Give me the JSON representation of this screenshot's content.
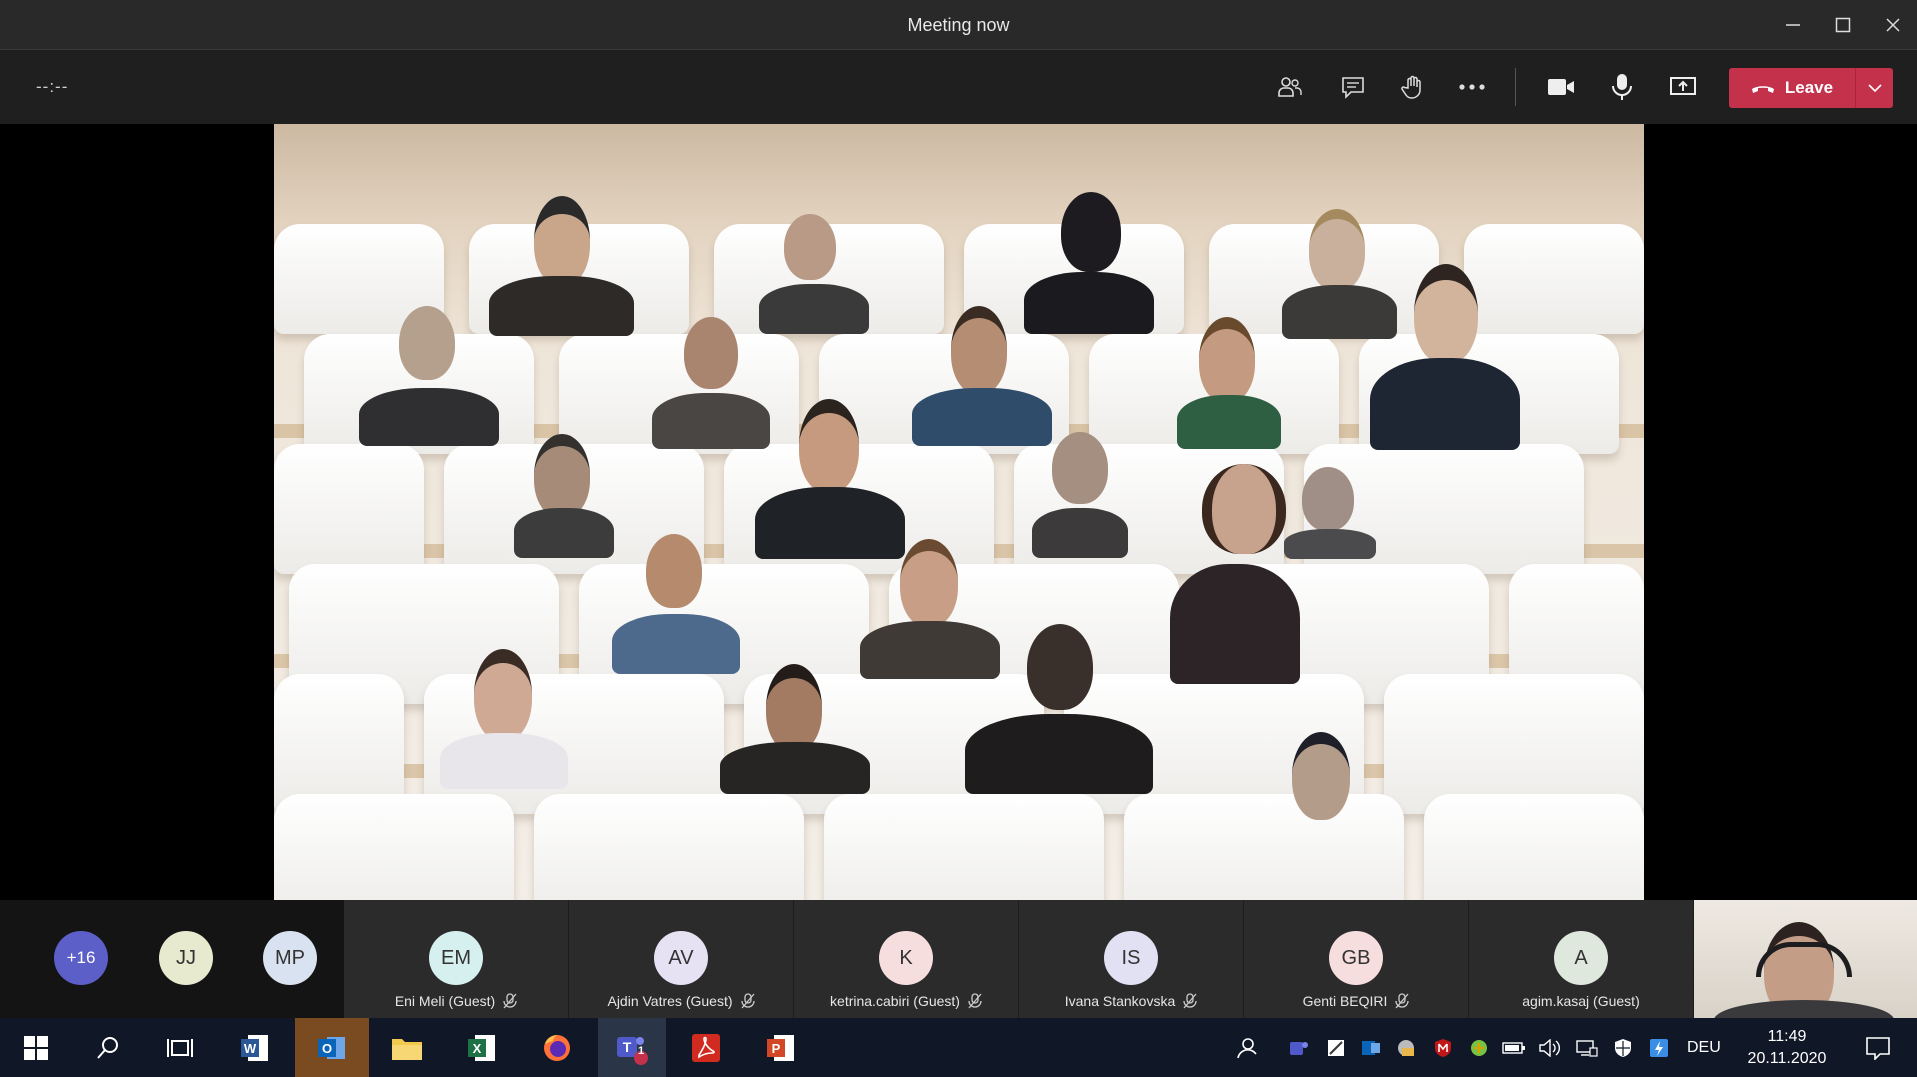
{
  "window": {
    "title": "Meeting now"
  },
  "toolbar": {
    "timer": "--:--",
    "leave_label": "Leave"
  },
  "roster": {
    "overflow_count": "+16",
    "compact": [
      {
        "initials": "JJ",
        "color": "#e8ead0"
      },
      {
        "initials": "MP",
        "color": "#d9e2f0"
      }
    ],
    "participants": [
      {
        "initials": "EM",
        "name": "Eni Meli (Guest)",
        "color": "#d5f0ee"
      },
      {
        "initials": "AV",
        "name": "Ajdin Vatres (Guest)",
        "color": "#e6e2f3"
      },
      {
        "initials": "K",
        "name": "ketrina.cabiri (Guest)",
        "color": "#f6dede"
      },
      {
        "initials": "IS",
        "name": "Ivana Stankovska",
        "color": "#e2e0f3"
      },
      {
        "initials": "GB",
        "name": "Genti BEQIRI",
        "color": "#f6dede"
      },
      {
        "initials": "A",
        "name": "agim.kasaj (Guest)",
        "color": "#dfe8dc"
      }
    ]
  },
  "taskbar": {
    "language": "DEU",
    "time": "11:49",
    "date": "20.11.2020",
    "teams_badge": "1"
  },
  "colors": {
    "leave": "#c4314b",
    "overflow_avatar": "#5b5fc7",
    "taskbar": "#101828"
  }
}
